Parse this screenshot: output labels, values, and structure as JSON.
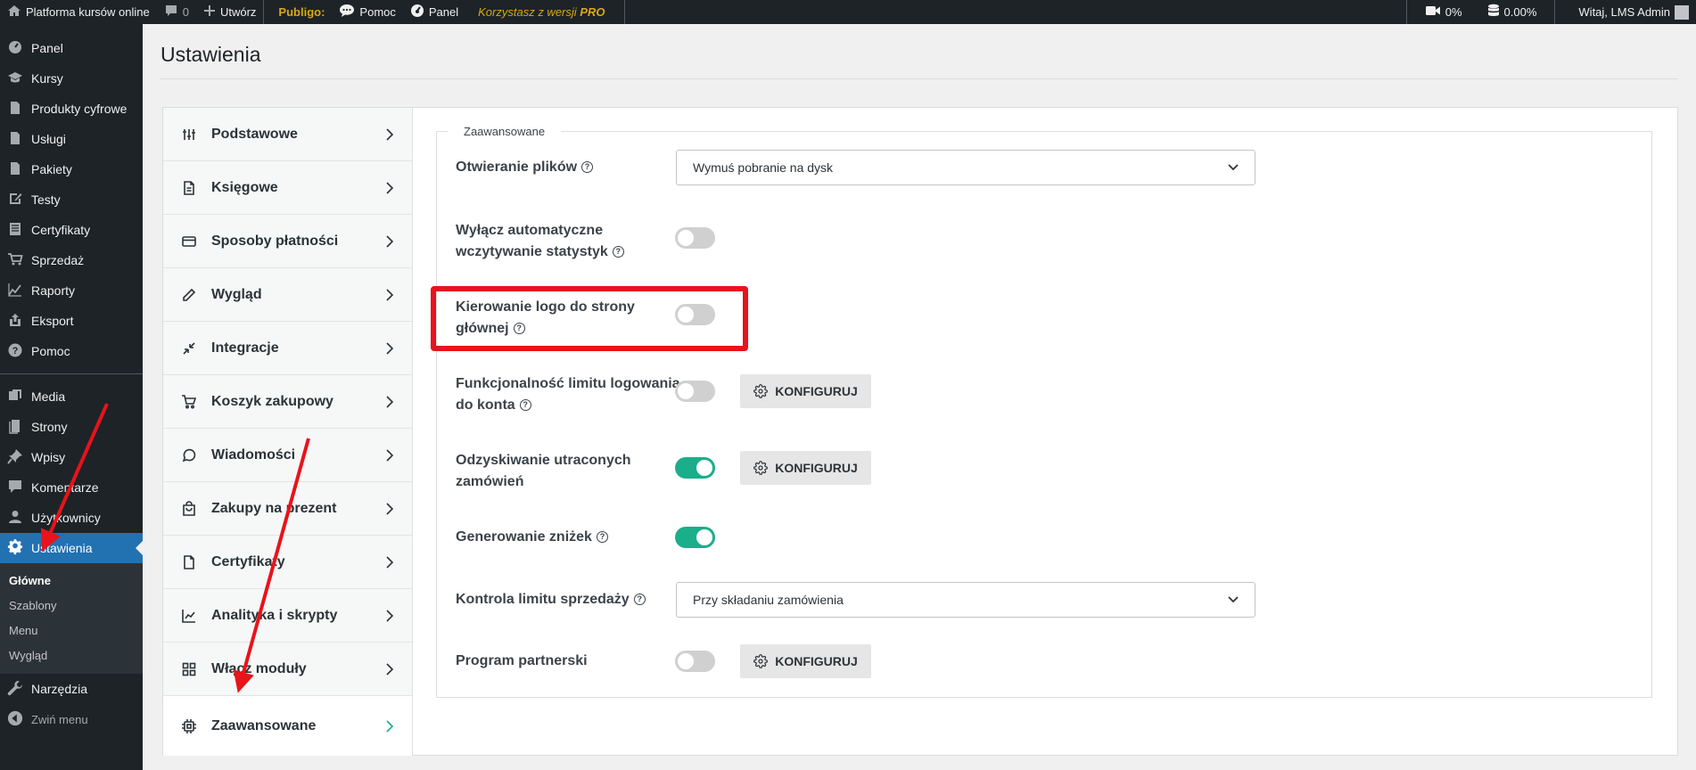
{
  "adminbar": {
    "site_name": "Platforma kursów online",
    "comments_count": "0",
    "new_label": "Utwórz",
    "publigo_label": "Publigo:",
    "help_label": "Pomoc",
    "panel_label": "Panel",
    "version_note_prefix": "Korzystasz z wersji ",
    "version_note_plan": "PRO",
    "video_percent": "0%",
    "storage_percent": "0.00%",
    "greeting": "Witaj, LMS Admin"
  },
  "sidebar": {
    "items_top": [
      {
        "label": "Panel",
        "icon": "gauge-icon"
      },
      {
        "label": "Kursy",
        "icon": "graduation-cap-icon"
      },
      {
        "label": "Produkty cyfrowe",
        "icon": "document-icon"
      },
      {
        "label": "Usługi",
        "icon": "document-icon"
      },
      {
        "label": "Pakiety",
        "icon": "document-icon"
      },
      {
        "label": "Testy",
        "icon": "edit-icon"
      },
      {
        "label": "Certyfikaty",
        "icon": "list-icon"
      },
      {
        "label": "Sprzedaż",
        "icon": "cart-icon"
      },
      {
        "label": "Raporty",
        "icon": "chart-icon"
      },
      {
        "label": "Eksport",
        "icon": "export-icon"
      },
      {
        "label": "Pomoc",
        "icon": "help-icon"
      }
    ],
    "items_bottom": [
      {
        "label": "Media",
        "icon": "media-icon"
      },
      {
        "label": "Strony",
        "icon": "page-icon"
      },
      {
        "label": "Wpisy",
        "icon": "pin-icon"
      },
      {
        "label": "Komentarze",
        "icon": "comment-icon"
      },
      {
        "label": "Użytkownicy",
        "icon": "user-icon"
      }
    ],
    "active_label": "Ustawienia",
    "submenu": [
      "Główne",
      "Szablony",
      "Menu",
      "Wygląd"
    ],
    "tools_label": "Narzędzia",
    "collapse_label": "Zwiń menu"
  },
  "page": {
    "title": "Ustawienia"
  },
  "settings_nav": [
    {
      "label": "Podstawowe",
      "icon": "sliders-icon"
    },
    {
      "label": "Księgowe",
      "icon": "file-text-icon"
    },
    {
      "label": "Sposoby płatności",
      "icon": "credit-card-icon"
    },
    {
      "label": "Wygląd",
      "icon": "pencil-icon"
    },
    {
      "label": "Integracje",
      "icon": "minimize-icon"
    },
    {
      "label": "Koszyk zakupowy",
      "icon": "cart-icon"
    },
    {
      "label": "Wiadomości",
      "icon": "message-circle-icon"
    },
    {
      "label": "Zakupy na prezent",
      "icon": "gift-bag-icon"
    },
    {
      "label": "Certyfikaty",
      "icon": "file-icon"
    },
    {
      "label": "Analityka i skrypty",
      "icon": "line-chart-icon"
    },
    {
      "label": "Włącz moduły",
      "icon": "grid-icon"
    },
    {
      "label": "Zaawansowane",
      "icon": "cpu-icon",
      "active": true
    }
  ],
  "section": {
    "legend": "Zaawansowane",
    "file_opening": {
      "label": "Otwieranie plików",
      "value": "Wymuś pobranie na dysk"
    },
    "disable_stats": {
      "label_line1": "Wyłącz automatyczne",
      "label_line2": "wczytywanie statystyk",
      "enabled": false
    },
    "logo_home": {
      "label_line1": "Kierowanie logo do strony",
      "label_line2": "głównej",
      "enabled": false
    },
    "login_limit": {
      "label_line1": "Funkcjonalność limitu logowania",
      "label_line2": "do konta",
      "enabled": false
    },
    "recover_orders": {
      "label_line1": "Odzyskiwanie utraconych",
      "label_line2": "zamówień",
      "enabled": true
    },
    "discounts": {
      "label": "Generowanie zniżek",
      "enabled": true
    },
    "sales_limit": {
      "label": "Kontrola limitu sprzedaży",
      "value": "Przy składaniu zamówienia"
    },
    "affiliate": {
      "label": "Program partnerski",
      "enabled": false
    },
    "configure_label": "KONFIGURUJ"
  },
  "colors": {
    "accent": "#1aae8b",
    "wp_blue": "#2271b1",
    "annotation_red": "#e8131b"
  }
}
